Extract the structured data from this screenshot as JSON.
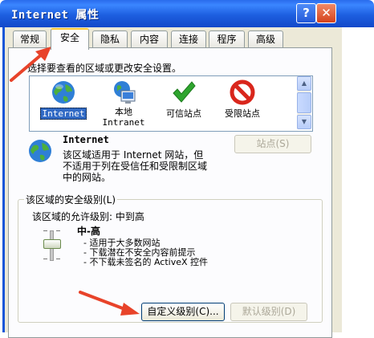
{
  "window": {
    "title": "Internet 属性",
    "help_label": "?",
    "close_label": "✕"
  },
  "tabs": [
    {
      "label": "常规"
    },
    {
      "label": "安全"
    },
    {
      "label": "隐私"
    },
    {
      "label": "内容"
    },
    {
      "label": "连接"
    },
    {
      "label": "程序"
    },
    {
      "label": "高级"
    }
  ],
  "active_tab": "安全",
  "security": {
    "instruction": "选择要查看的区域或更改安全设置。",
    "zones": [
      {
        "label_line1": "Internet",
        "label_line2": "",
        "icon": "globe-icon"
      },
      {
        "label_line1": "本地",
        "label_line2": "Intranet",
        "icon": "local-intranet-icon"
      },
      {
        "label_line1": "可信站点",
        "label_line2": "",
        "icon": "checkmark-icon"
      },
      {
        "label_line1": "受限站点",
        "label_line2": "",
        "icon": "restricted-icon"
      }
    ],
    "selected_zone": "Internet",
    "zone_title": "Internet",
    "zone_desc_line1": "该区域适用于 Internet 网站，但",
    "zone_desc_line2": "不适用于列在受信任和受限制区域",
    "zone_desc_line3": "中的网站。",
    "sites_button": "站点(S)",
    "level_group_label": "该区域的安全级别(L)",
    "allowed_levels": "该区域的允许级别: 中到高",
    "level_name": "中-高",
    "level_bullets": [
      "- 适用于大多数网站",
      "- 下载潜在不安全内容前提示",
      "- 不下载未签名的 ActiveX 控件"
    ],
    "custom_level_button": "自定义级别(C)...",
    "default_level_button": "默认级别(D)"
  },
  "colors": {
    "accent_arrow": "#e8432a",
    "title_blue": "#1d5fe0",
    "selection": "#316ac5"
  }
}
